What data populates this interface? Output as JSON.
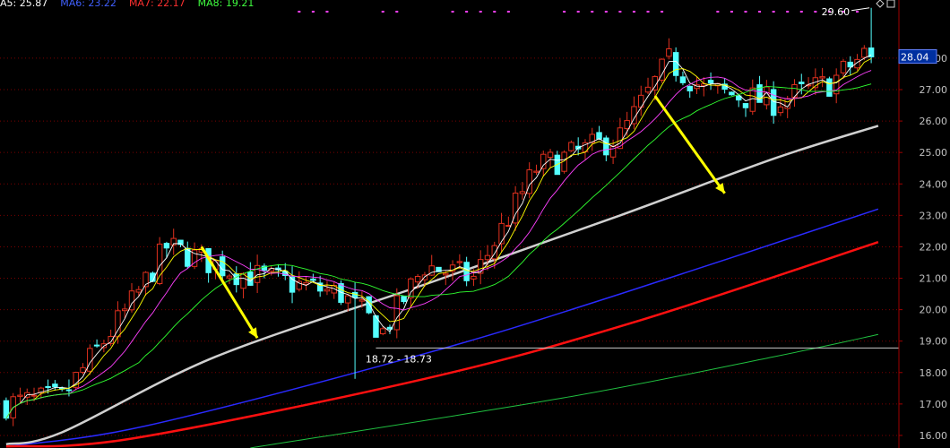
{
  "legend": {
    "ma5": "A5: 25.87",
    "ma6": "MA6: 23.22",
    "ma7": "MA7: 22.17",
    "ma8": "MA8: 19.21"
  },
  "colors": {
    "background": "#000000",
    "grid": "#7a0000",
    "axis": "#a00000",
    "tick_text": "#c0c0c0",
    "up": "#e0301e",
    "down": "#54ffff",
    "ma5": "#ffffff",
    "ma6": "#ffff00",
    "ma7": "#ff40ff",
    "ma8": "#30ff30",
    "ma60": "#d0d0d0",
    "ma_long_blue": "#2a2aff",
    "ma_long_red": "#ff1010",
    "ma_long_green": "#20c040",
    "arrow": "#ffff00",
    "price_box": "#0030a0",
    "signal_marks": "#ff40ff"
  },
  "chart_data": {
    "type": "candlestick",
    "ylim": [
      15.6,
      29.85
    ],
    "yticks": [
      "16.00",
      "17.00",
      "18.00",
      "19.00",
      "20.00",
      "21.00",
      "22.00",
      "23.00",
      "24.00",
      "25.00",
      "26.00",
      "27.00",
      "28.00"
    ],
    "current_price": "28.04",
    "high_annotation": "29.60",
    "low_annotation": "18.72 - 18.73",
    "support_level": 18.78,
    "legend": [
      "A5: 25.87",
      "MA6: 23.22",
      "MA7: 22.17",
      "MA8: 19.21"
    ],
    "trend": [
      {
        "from": 0,
        "to": 8,
        "start": 17.0,
        "end": 17.2
      },
      {
        "from": 8,
        "to": 18,
        "start": 17.2,
        "end": 20.2
      },
      {
        "from": 18,
        "to": 23,
        "start": 20.2,
        "end": 22.0
      },
      {
        "from": 23,
        "to": 33,
        "start": 22.0,
        "end": 21.2
      },
      {
        "from": 33,
        "to": 48,
        "start": 21.2,
        "end": 20.5
      },
      {
        "from": 48,
        "to": 54,
        "start": 20.5,
        "end": 19.3
      },
      {
        "from": 54,
        "to": 60,
        "start": 19.3,
        "end": 21.4
      },
      {
        "from": 60,
        "to": 67,
        "start": 21.4,
        "end": 21.0
      },
      {
        "from": 67,
        "to": 76,
        "start": 21.0,
        "end": 24.5
      },
      {
        "from": 76,
        "to": 88,
        "start": 24.5,
        "end": 25.5
      },
      {
        "from": 88,
        "to": 95,
        "start": 25.5,
        "end": 27.9
      },
      {
        "from": 95,
        "to": 100,
        "start": 27.9,
        "end": 27.0
      },
      {
        "from": 100,
        "to": 110,
        "start": 27.0,
        "end": 26.6
      },
      {
        "from": 110,
        "to": 118,
        "start": 26.6,
        "end": 27.2
      },
      {
        "from": 118,
        "to": 125,
        "start": 27.2,
        "end": 28.5
      }
    ],
    "count": 125,
    "ma_long": {
      "ma60": [
        [
          0,
          15.72
        ],
        [
          8,
          16.1
        ],
        [
          30,
          18.5
        ],
        [
          60,
          20.8
        ],
        [
          88,
          23.0
        ],
        [
          110,
          24.8
        ],
        [
          125,
          25.85
        ]
      ],
      "blue": [
        [
          0,
          15.65
        ],
        [
          20,
          16.3
        ],
        [
          60,
          18.6
        ],
        [
          88,
          20.5
        ],
        [
          125,
          23.2
        ]
      ],
      "red": [
        [
          0,
          15.65
        ],
        [
          18,
          15.9
        ],
        [
          60,
          17.8
        ],
        [
          90,
          19.6
        ],
        [
          125,
          22.15
        ]
      ],
      "green": [
        [
          35,
          15.6
        ],
        [
          80,
          17.2
        ],
        [
          110,
          18.5
        ],
        [
          125,
          19.21
        ]
      ]
    },
    "arrows": [
      {
        "from": [
          28,
          22.0
        ],
        "to": [
          36,
          19.1
        ]
      },
      {
        "from": [
          93,
          26.8
        ],
        "to": [
          103,
          23.7
        ]
      }
    ]
  }
}
